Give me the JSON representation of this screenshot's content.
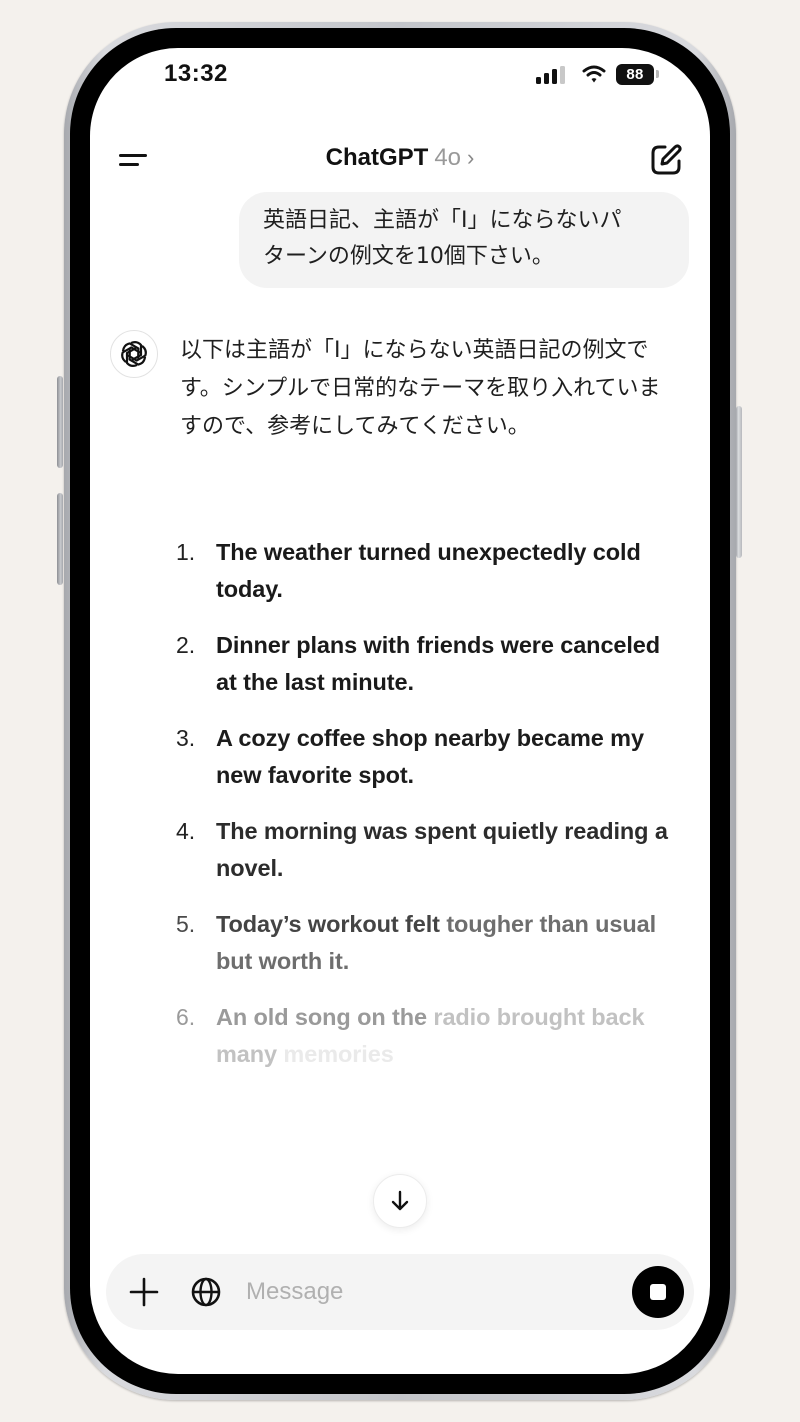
{
  "status_bar": {
    "time": "13:32",
    "signal_bars_active": 3,
    "signal_bars_total": 4,
    "battery_percent": "88"
  },
  "header": {
    "title": "ChatGPT",
    "model": "4o",
    "chevron": "›",
    "menu_icon": "sidebar-menu-icon",
    "new_chat_icon": "new-chat-pencil-icon"
  },
  "conversation": {
    "user_message": {
      "line1": "英語日記、主語が「I」にならないパ",
      "line2": "ターンの例文を10個下さい。"
    },
    "assistant": {
      "avatar_icon": "openai-logo-icon",
      "intro": "以下は主語が「I」にならない英語日記の例文です。シンプルで日常的なテーマを取り入れていますので、参考にしてみてください。",
      "examples": [
        {
          "num": "1.",
          "segments": [
            {
              "text": "The weather turned unexpectedly cold today.",
              "color": "#1a1a1a"
            }
          ]
        },
        {
          "num": "2.",
          "segments": [
            {
              "text": "Dinner plans with friends were canceled at the last minute.",
              "color": "#1a1a1a"
            }
          ]
        },
        {
          "num": "3.",
          "segments": [
            {
              "text": "A cozy coffee shop nearby became my new favorite spot.",
              "color": "#1c1c1c"
            }
          ]
        },
        {
          "num": "4.",
          "segments": [
            {
              "text": "The morning was spent quietly reading a novel.",
              "color": "#2c2c2c"
            }
          ]
        },
        {
          "num": "5.",
          "num_color": "#4a4a4a",
          "segments": [
            {
              "text": "Today’s workout felt ",
              "color": "#444444"
            },
            {
              "text": "tougher than usual but worth it.",
              "color": "#6e6e6e"
            }
          ]
        },
        {
          "num": "6.",
          "num_color": "#9a9a9a",
          "segments": [
            {
              "text": "An old song on the ",
              "color": "#9a9a9a"
            },
            {
              "text": "radio brought back many",
              "color": "#c2c2c2"
            },
            {
              "text": " memories",
              "color": "#eaeaea"
            }
          ]
        }
      ]
    }
  },
  "scroll_button": {
    "icon": "arrow-down-icon"
  },
  "composer": {
    "placeholder": "Message",
    "value": "",
    "attach_icon": "plus-icon",
    "search_icon": "globe-icon",
    "stop_icon": "stop-icon"
  }
}
